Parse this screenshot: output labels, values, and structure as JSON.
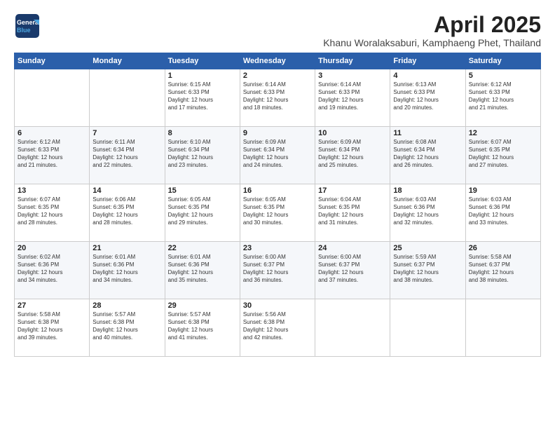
{
  "logo": {
    "line1": "General",
    "line2": "Blue"
  },
  "title": "April 2025",
  "location": "Khanu Woralaksaburi, Kamphaeng Phet, Thailand",
  "headers": [
    "Sunday",
    "Monday",
    "Tuesday",
    "Wednesday",
    "Thursday",
    "Friday",
    "Saturday"
  ],
  "weeks": [
    [
      {
        "day": "",
        "info": ""
      },
      {
        "day": "",
        "info": ""
      },
      {
        "day": "1",
        "info": "Sunrise: 6:15 AM\nSunset: 6:33 PM\nDaylight: 12 hours\nand 17 minutes."
      },
      {
        "day": "2",
        "info": "Sunrise: 6:14 AM\nSunset: 6:33 PM\nDaylight: 12 hours\nand 18 minutes."
      },
      {
        "day": "3",
        "info": "Sunrise: 6:14 AM\nSunset: 6:33 PM\nDaylight: 12 hours\nand 19 minutes."
      },
      {
        "day": "4",
        "info": "Sunrise: 6:13 AM\nSunset: 6:33 PM\nDaylight: 12 hours\nand 20 minutes."
      },
      {
        "day": "5",
        "info": "Sunrise: 6:12 AM\nSunset: 6:33 PM\nDaylight: 12 hours\nand 21 minutes."
      }
    ],
    [
      {
        "day": "6",
        "info": "Sunrise: 6:12 AM\nSunset: 6:33 PM\nDaylight: 12 hours\nand 21 minutes."
      },
      {
        "day": "7",
        "info": "Sunrise: 6:11 AM\nSunset: 6:34 PM\nDaylight: 12 hours\nand 22 minutes."
      },
      {
        "day": "8",
        "info": "Sunrise: 6:10 AM\nSunset: 6:34 PM\nDaylight: 12 hours\nand 23 minutes."
      },
      {
        "day": "9",
        "info": "Sunrise: 6:09 AM\nSunset: 6:34 PM\nDaylight: 12 hours\nand 24 minutes."
      },
      {
        "day": "10",
        "info": "Sunrise: 6:09 AM\nSunset: 6:34 PM\nDaylight: 12 hours\nand 25 minutes."
      },
      {
        "day": "11",
        "info": "Sunrise: 6:08 AM\nSunset: 6:34 PM\nDaylight: 12 hours\nand 26 minutes."
      },
      {
        "day": "12",
        "info": "Sunrise: 6:07 AM\nSunset: 6:35 PM\nDaylight: 12 hours\nand 27 minutes."
      }
    ],
    [
      {
        "day": "13",
        "info": "Sunrise: 6:07 AM\nSunset: 6:35 PM\nDaylight: 12 hours\nand 28 minutes."
      },
      {
        "day": "14",
        "info": "Sunrise: 6:06 AM\nSunset: 6:35 PM\nDaylight: 12 hours\nand 28 minutes."
      },
      {
        "day": "15",
        "info": "Sunrise: 6:05 AM\nSunset: 6:35 PM\nDaylight: 12 hours\nand 29 minutes."
      },
      {
        "day": "16",
        "info": "Sunrise: 6:05 AM\nSunset: 6:35 PM\nDaylight: 12 hours\nand 30 minutes."
      },
      {
        "day": "17",
        "info": "Sunrise: 6:04 AM\nSunset: 6:35 PM\nDaylight: 12 hours\nand 31 minutes."
      },
      {
        "day": "18",
        "info": "Sunrise: 6:03 AM\nSunset: 6:36 PM\nDaylight: 12 hours\nand 32 minutes."
      },
      {
        "day": "19",
        "info": "Sunrise: 6:03 AM\nSunset: 6:36 PM\nDaylight: 12 hours\nand 33 minutes."
      }
    ],
    [
      {
        "day": "20",
        "info": "Sunrise: 6:02 AM\nSunset: 6:36 PM\nDaylight: 12 hours\nand 34 minutes."
      },
      {
        "day": "21",
        "info": "Sunrise: 6:01 AM\nSunset: 6:36 PM\nDaylight: 12 hours\nand 34 minutes."
      },
      {
        "day": "22",
        "info": "Sunrise: 6:01 AM\nSunset: 6:36 PM\nDaylight: 12 hours\nand 35 minutes."
      },
      {
        "day": "23",
        "info": "Sunrise: 6:00 AM\nSunset: 6:37 PM\nDaylight: 12 hours\nand 36 minutes."
      },
      {
        "day": "24",
        "info": "Sunrise: 6:00 AM\nSunset: 6:37 PM\nDaylight: 12 hours\nand 37 minutes."
      },
      {
        "day": "25",
        "info": "Sunrise: 5:59 AM\nSunset: 6:37 PM\nDaylight: 12 hours\nand 38 minutes."
      },
      {
        "day": "26",
        "info": "Sunrise: 5:58 AM\nSunset: 6:37 PM\nDaylight: 12 hours\nand 38 minutes."
      }
    ],
    [
      {
        "day": "27",
        "info": "Sunrise: 5:58 AM\nSunset: 6:38 PM\nDaylight: 12 hours\nand 39 minutes."
      },
      {
        "day": "28",
        "info": "Sunrise: 5:57 AM\nSunset: 6:38 PM\nDaylight: 12 hours\nand 40 minutes."
      },
      {
        "day": "29",
        "info": "Sunrise: 5:57 AM\nSunset: 6:38 PM\nDaylight: 12 hours\nand 41 minutes."
      },
      {
        "day": "30",
        "info": "Sunrise: 5:56 AM\nSunset: 6:38 PM\nDaylight: 12 hours\nand 42 minutes."
      },
      {
        "day": "",
        "info": ""
      },
      {
        "day": "",
        "info": ""
      },
      {
        "day": "",
        "info": ""
      }
    ]
  ]
}
